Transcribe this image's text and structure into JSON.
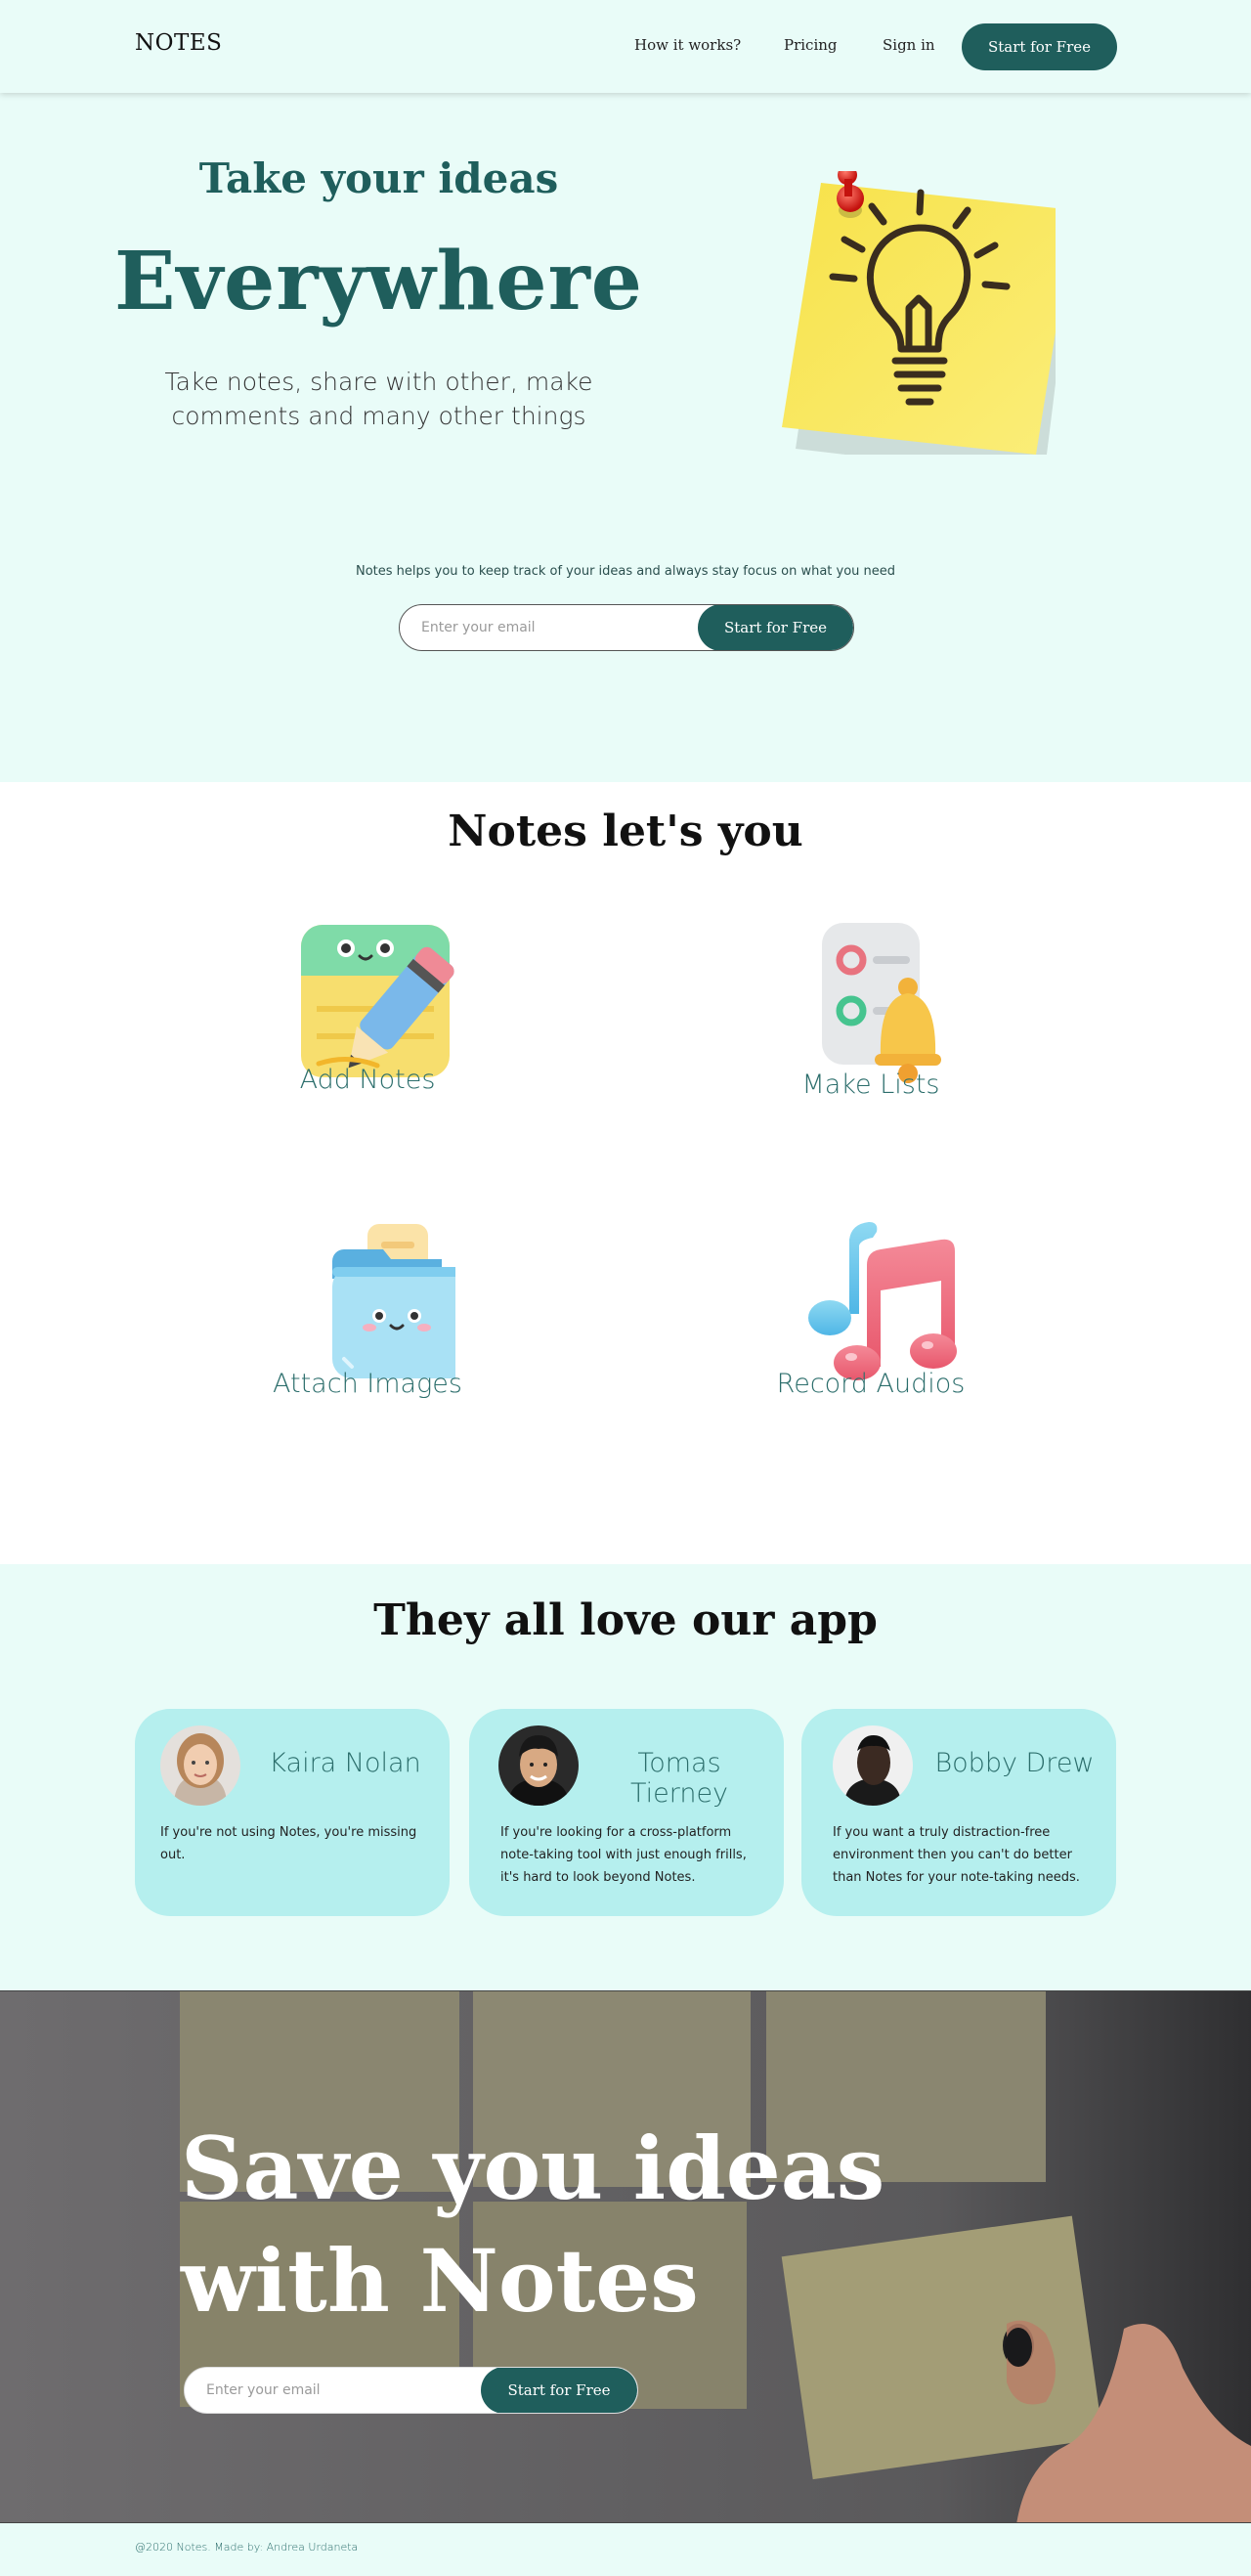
{
  "nav": {
    "logo": "NOTES",
    "links": [
      "How it works?",
      "Pricing",
      "Sign in"
    ],
    "cta": "Start for Free"
  },
  "hero": {
    "kicker": "Take your ideas",
    "title": "Everywhere",
    "subtitle": "Take notes, share with other, make comments and many other things",
    "note": "Notes helps you to keep track of your ideas and always stay focus on what you need",
    "email_placeholder": "Enter your email",
    "button": "Start for Free"
  },
  "features": {
    "title": "Notes let's you",
    "items": [
      {
        "label": "Add Notes",
        "icon": "notepad-pencil-icon"
      },
      {
        "label": "Make Lists",
        "icon": "checklist-bell-icon"
      },
      {
        "label": "Attach Images",
        "icon": "folder-icon"
      },
      {
        "label": "Record Audios",
        "icon": "music-notes-icon"
      }
    ]
  },
  "testimonials": {
    "title": "They all love our app",
    "cards": [
      {
        "name": "Kaira Nolan",
        "quote": "If you're not using Notes, you're missing out."
      },
      {
        "name": "Tomas Tierney",
        "quote": "If you're looking for a cross-platform note-taking tool with just enough frills, it's hard to look beyond Notes."
      },
      {
        "name": "Bobby Drew",
        "quote": "If you want a truly distraction-free environment then you can't do better than Notes for your note-taking needs."
      }
    ]
  },
  "cta": {
    "title_line1": "Save you ideas",
    "title_line2": "with Notes",
    "email_placeholder": "Enter your email",
    "button": "Start for Free"
  },
  "footer": {
    "text": "@2020 Notes. Made by: Andrea Urdaneta"
  },
  "colors": {
    "brand": "#1f5e5c",
    "mint_background": "#e9fcf8",
    "card_background": "#b5efee",
    "label_teal": "#2c6e6c"
  }
}
